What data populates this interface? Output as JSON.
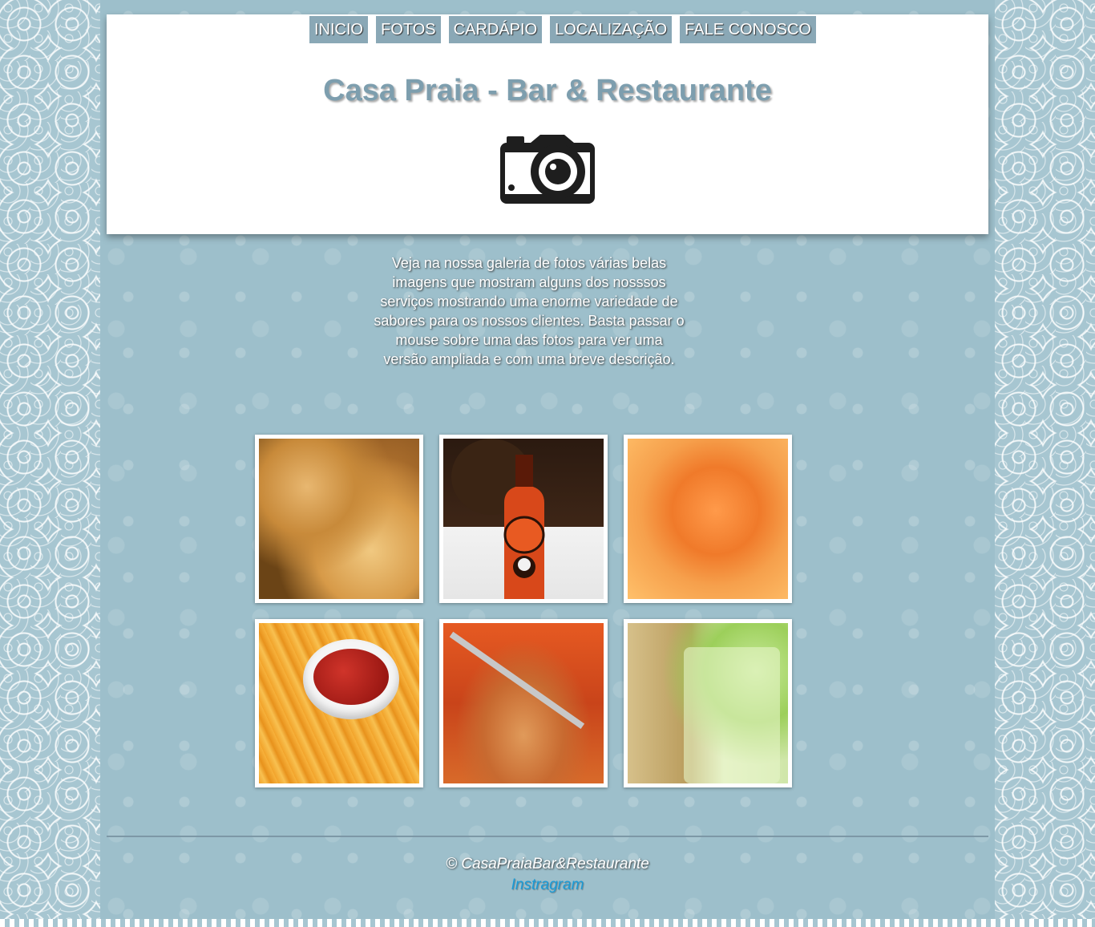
{
  "nav": {
    "items": [
      "INICIO",
      "FOTOS",
      "CARDÁPIO",
      "LOCALIZAÇÃO",
      "FALE CONOSCO"
    ]
  },
  "header": {
    "title": "Casa Praia - Bar & Restaurante",
    "icon": "camera-icon"
  },
  "intro": {
    "text": " Veja na nossa galeria de fotos várias belas imagens que mostram alguns dos nosssos serviços mostrando uma enorme variedade de sabores para os nossos clientes. Basta passar o mouse sobre uma das fotos para ver uma versão ampliada e com uma breve descrição."
  },
  "gallery": {
    "photos": [
      "fried-pastry-photo",
      "beer-bottle-photo",
      "shrimp-photo",
      "fries-ketchup-photo",
      "fish-stew-photo",
      "caipirinha-photo"
    ]
  },
  "footer": {
    "copyright": "© CasaPraiaBar&Restaurante",
    "instagram_label": "Instragram"
  },
  "colors": {
    "background": "#9dbfcb",
    "nav_button": "#8aa8b6",
    "title": "#7d9eae",
    "link": "#1a9ad6"
  }
}
